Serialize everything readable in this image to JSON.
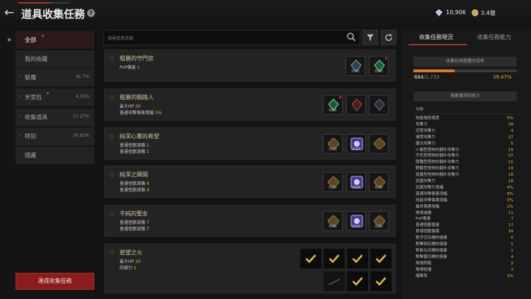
{
  "header": {
    "title": "道具收集任務",
    "currency": [
      {
        "icon": "diamond-icon",
        "value": "10,906"
      },
      {
        "icon": "coin-icon",
        "value": "3.4億"
      }
    ]
  },
  "sidebar": {
    "items": [
      {
        "label": "全部",
        "pct": "",
        "active": true
      },
      {
        "label": "我的收藏",
        "pct": ""
      },
      {
        "label": "裝備",
        "pct": "41.7%"
      },
      {
        "label": "天堂石",
        "pct": "4.35%"
      },
      {
        "label": "收集道具",
        "pct": "27.27%"
      },
      {
        "label": "特別",
        "pct": "76.92%"
      },
      {
        "label": "隱藏",
        "pct": ""
      }
    ],
    "complete_button": "達成收集任務"
  },
  "search": {
    "placeholder": "搜尋道具名稱"
  },
  "quests": [
    {
      "name": "粗暴的守門官",
      "stats": [
        {
          "label": "PvP傷害 ",
          "value": "1"
        }
      ],
      "slots": [
        {
          "count": "0/10"
        },
        {
          "count": "0/10"
        }
      ]
    },
    {
      "name": "粗暴的鋼路人",
      "stats": [
        {
          "label": "最大HP ",
          "value": "20"
        },
        {
          "label": "普通攻擊傷害增幅 ",
          "value": "1%"
        }
      ],
      "slots": [
        {
          "count": "0/20"
        },
        {
          "count": ""
        },
        {
          "count": ""
        }
      ]
    },
    {
      "name": "純潔心靈的希望",
      "stats": [
        {
          "label": "普通怪獸減傷 ",
          "value": "1"
        },
        {
          "label": "普通怪獸減傷 ",
          "value": "1"
        }
      ],
      "slots": [
        {
          "count": "0/10"
        },
        {
          "count": "0/10"
        },
        {
          "count": ""
        }
      ]
    },
    {
      "name": "純潔之瞬間",
      "stats": [
        {
          "label": "普通怪獸減傷 ",
          "value": "4"
        },
        {
          "label": "普通怪獸減傷 ",
          "value": "4"
        }
      ],
      "slots": [
        {
          "count": "0/20"
        },
        {
          "count": "0/20"
        },
        {
          "count": "0/20"
        }
      ]
    },
    {
      "name": "不純的聖女",
      "stats": [
        {
          "label": "普通怪獸減傷 ",
          "value": "7"
        },
        {
          "label": "普通怪獸減傷 ",
          "value": "7"
        }
      ],
      "slots": [
        {
          "count": "0/30"
        },
        {
          "count": "0/30"
        },
        {
          "count": "0/30"
        }
      ]
    },
    {
      "name": "慾望之火",
      "stats": [
        {
          "label": "最大HP ",
          "value": "20"
        },
        {
          "label": "防禦力 ",
          "value": "1"
        }
      ],
      "slots": []
    }
  ],
  "right": {
    "tabs": [
      "收集任務現況",
      "收集任務能力"
    ],
    "progress_title": "收集任務整體完成率",
    "progress_count": "684",
    "progress_total": "/1,733",
    "progress_pct": "39.47%",
    "progress_fraction": 0.3947,
    "ability_title": "蒐集獲得的能力",
    "section_label": "攻擊",
    "stats": [
      {
        "label": "技能施放速度",
        "value": "5%"
      },
      {
        "label": "攻擊力",
        "value": "28"
      },
      {
        "label": "近程攻擊力",
        "value": "4"
      },
      {
        "label": "遠程攻擊力",
        "value": "27"
      },
      {
        "label": "魔法攻擊力",
        "value": "5"
      },
      {
        "label": "人類型怪物的額外攻擊力",
        "value": "19"
      },
      {
        "label": "不死型怪物的額外攻擊力",
        "value": "27"
      },
      {
        "label": "龍種型怪物的額外攻擊力",
        "value": "22"
      },
      {
        "label": "野獸型怪物的額外攻擊力",
        "value": "19"
      },
      {
        "label": "惡魔型怪物的額外攻擊力",
        "value": "18"
      },
      {
        "label": "武器攻擊力",
        "value": "18"
      },
      {
        "label": "武器攻擊力增幅",
        "value": "4%"
      },
      {
        "label": "普通攻擊傷害增幅",
        "value": "6%"
      },
      {
        "label": "技能攻擊傷害增幅",
        "value": "3%"
      },
      {
        "label": "最終傷害增幅",
        "value": "2%"
      },
      {
        "label": "無視減傷",
        "value": "11"
      },
      {
        "label": "PvP傷害",
        "value": "7"
      },
      {
        "label": "普通怪獸傷害",
        "value": "17"
      },
      {
        "label": "首領怪獸傷害",
        "value": "34"
      },
      {
        "label": "對浮空目標的傷害",
        "value": "6"
      },
      {
        "label": "對擊倒目標的傷害",
        "value": "5"
      },
      {
        "label": "對氣化目標的傷害",
        "value": "1"
      },
      {
        "label": "對擊暈目標的傷害",
        "value": "4"
      },
      {
        "label": "無視閃避",
        "value": "2"
      },
      {
        "label": "無視抵擋",
        "value": "3"
      },
      {
        "label": "爆擊率",
        "value": "3%"
      }
    ]
  }
}
